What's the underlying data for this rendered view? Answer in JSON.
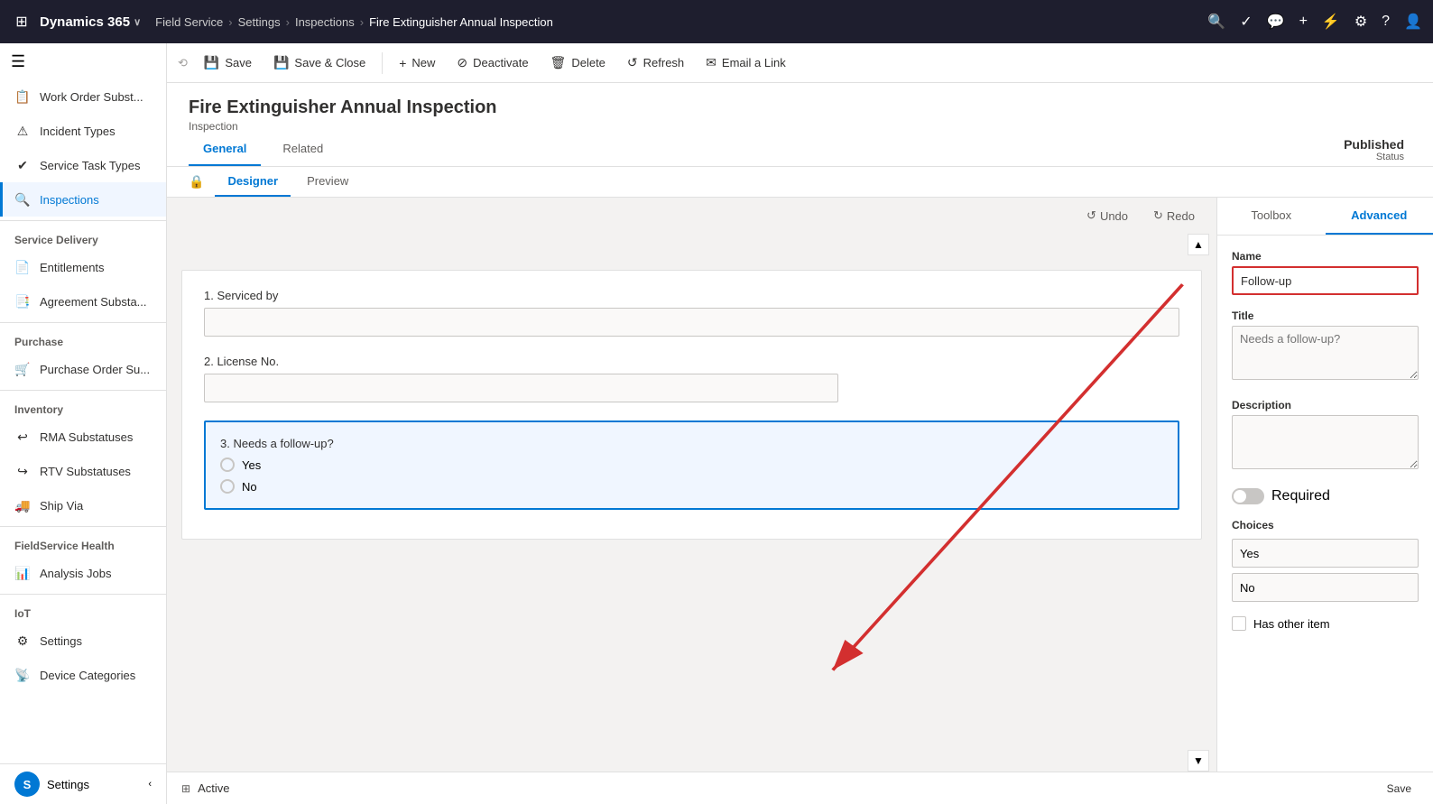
{
  "topnav": {
    "waffle_icon": "⊞",
    "app_name": "Dynamics 365",
    "chevron": "∨",
    "module": "Field Service",
    "breadcrumbs": [
      "Settings",
      "Inspections",
      "Fire Extinguisher Annual Inspection"
    ],
    "icons": [
      "🔍",
      "✓",
      "💬",
      "+",
      "⚡",
      "⚙",
      "?",
      "👤"
    ]
  },
  "sidebar": {
    "hamburger": "☰",
    "groups": [
      {
        "items": [
          {
            "id": "work-order",
            "icon": "📋",
            "label": "Work Order Subst..."
          },
          {
            "id": "incident-types",
            "icon": "⚠",
            "label": "Incident Types"
          },
          {
            "id": "service-task-types",
            "icon": "✔",
            "label": "Service Task Types"
          },
          {
            "id": "inspections",
            "icon": "🔍",
            "label": "Inspections",
            "active": true
          }
        ]
      },
      {
        "title": "Service Delivery",
        "items": [
          {
            "id": "entitlements",
            "icon": "📄",
            "label": "Entitlements"
          },
          {
            "id": "agreement-subst",
            "icon": "📑",
            "label": "Agreement Substa..."
          }
        ]
      },
      {
        "title": "Purchase",
        "items": [
          {
            "id": "purchase-order",
            "icon": "🛒",
            "label": "Purchase Order Su..."
          }
        ]
      },
      {
        "title": "Inventory",
        "items": [
          {
            "id": "rma-substatuses",
            "icon": "↩",
            "label": "RMA Substatuses"
          },
          {
            "id": "rtv-substatuses",
            "icon": "↪",
            "label": "RTV Substatuses"
          },
          {
            "id": "ship-via",
            "icon": "🚚",
            "label": "Ship Via"
          }
        ]
      },
      {
        "title": "FieldService Health",
        "items": [
          {
            "id": "analysis-jobs",
            "icon": "📊",
            "label": "Analysis Jobs"
          }
        ]
      },
      {
        "title": "IoT",
        "items": [
          {
            "id": "settings",
            "icon": "⚙",
            "label": "Settings"
          },
          {
            "id": "device-categories",
            "icon": "📡",
            "label": "Device Categories"
          }
        ]
      }
    ],
    "user_label": "S",
    "footer_label": "Settings"
  },
  "commandbar": {
    "history_icon": "⟲",
    "buttons": [
      {
        "id": "save",
        "icon": "💾",
        "label": "Save"
      },
      {
        "id": "save-close",
        "icon": "💾",
        "label": "Save & Close"
      },
      {
        "id": "new",
        "icon": "+",
        "label": "New"
      },
      {
        "id": "deactivate",
        "icon": "⊘",
        "label": "Deactivate"
      },
      {
        "id": "delete",
        "icon": "🗑",
        "label": "Delete"
      },
      {
        "id": "refresh",
        "icon": "↺",
        "label": "Refresh"
      },
      {
        "id": "email-link",
        "icon": "✉",
        "label": "Email a Link"
      }
    ]
  },
  "pageheader": {
    "title": "Fire Extinguisher Annual Inspection",
    "subtitle": "Inspection",
    "status_value": "Published",
    "status_label": "Status"
  },
  "tabs": {
    "main_tabs": [
      "General",
      "Related"
    ],
    "active_main": "General",
    "sub_tabs": [
      "Designer",
      "Preview"
    ],
    "active_sub": "Designer"
  },
  "canvas": {
    "undo_label": "Undo",
    "redo_label": "Redo",
    "fields": [
      {
        "id": "field1",
        "label": "1. Serviced by",
        "type": "text",
        "value": ""
      },
      {
        "id": "field2",
        "label": "2. License No.",
        "type": "text",
        "value": ""
      },
      {
        "id": "field3",
        "label": "3. Needs a follow-up?",
        "type": "radio",
        "options": [
          "Yes",
          "No"
        ],
        "selected": true
      }
    ]
  },
  "rightpanel": {
    "tabs": [
      "Toolbox",
      "Advanced"
    ],
    "active_tab": "Advanced",
    "fields": {
      "name_label": "Name",
      "name_value": "Follow-up",
      "title_label": "Title",
      "title_placeholder": "Needs a follow-up?",
      "description_label": "Description",
      "description_value": "",
      "required_label": "Required",
      "choices_label": "Choices",
      "choices": [
        "Yes",
        "No"
      ],
      "has_other_label": "Has other item"
    }
  },
  "statusbar": {
    "page_icon": "⊞",
    "status": "Active",
    "save_label": "Save"
  }
}
